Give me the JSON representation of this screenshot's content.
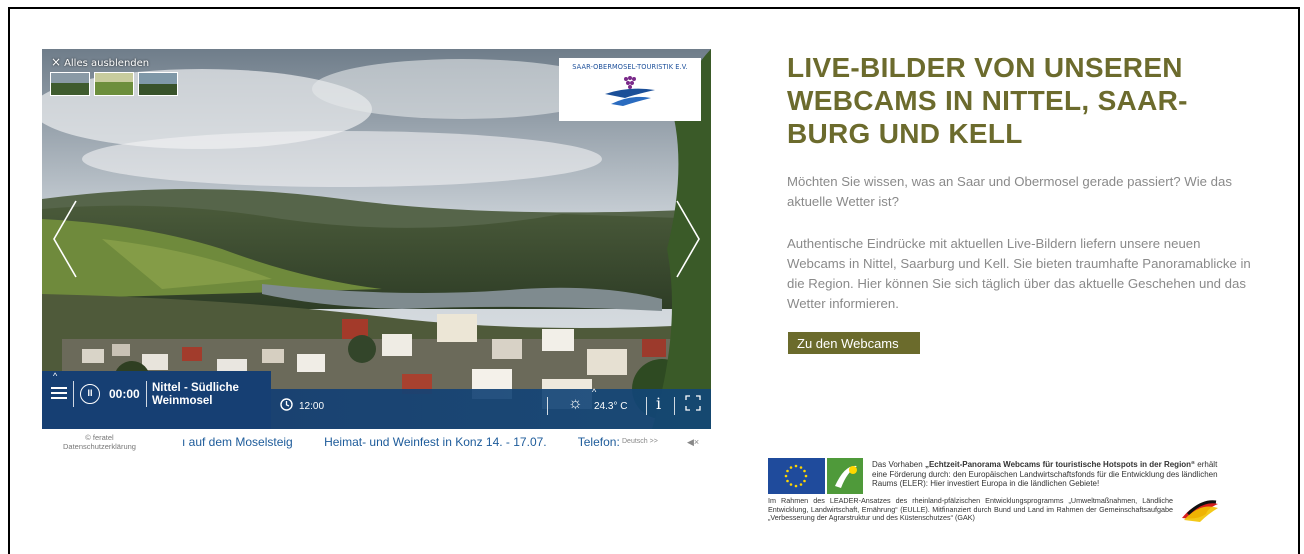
{
  "player": {
    "hide_all": "Alles ausblenden",
    "logo_text": "SAAR-OBERMOSEL-TOURISTIK E.V.",
    "time_elapsed": "00:00",
    "location_line1": "Nittel - Südliche",
    "location_line2": "Weinmosel",
    "clock_time": "12:00",
    "temperature": "24.3° C",
    "info_label": "i",
    "copyright_line1": "© feratel",
    "copyright_line2": "Datenschutzerklärung",
    "ticker_items": [
      "ı auf dem Moselsteig",
      "Heimat- und Weinfest in Konz 14. - 17.07.",
      "Telefon:"
    ],
    "language": "Deutsch >>",
    "colors": {
      "bar": "#163f73",
      "accent": "#1d5b9a"
    }
  },
  "content": {
    "headline": "LIVE-BILDER VON UNSEREN WEBCAMS IN NITTEL, SAAR-BURG UND KELL",
    "paragraph1": "Möchten Sie wissen, was an Saar und Obermosel gerade passiert? Wie das aktuelle Wetter ist?",
    "paragraph2": "Authentische Eindrücke mit aktuellen Live-Bildern liefern unsere neuen Webcams in Nittel, Saarburg und Kell. Sie bieten traumhafte Panoramablicke in die Region. Hier können Sie sich täglich über das aktuelle Geschehen und das Wetter informieren.",
    "cta_label": "Zu den Webcams",
    "colors": {
      "headline": "#6c6b2d",
      "button": "#6b6b2c",
      "text": "#8a8a8a"
    }
  },
  "funding": {
    "intro_prefix": "Das Vorhaben ",
    "project_name": "„Echtzeit-Panorama Webcams für touristische Hotspots in der Region“",
    "intro_rest": "erhält eine Förderung durch: den Europäischen Landwirtschaftsfonds für die Entwicklung des ländlichen Raums (ELER): Hier investiert Europa in die ländlichen Gebiete!",
    "program_text": "Im Rahmen des LEADER-Ansatzes des rheinland-pfälzischen Entwicklungsprogramms „Umweltmaßnahmen, Ländliche Entwicklung, Landwirtschaft, Ernährung“ (EULLE). Mitfinanziert durch Bund und Land im Rahmen der Gemeinschaftsaufgabe „Verbesserung der Agrarstruktur und des Küstenschutzes“ (GAK)"
  }
}
